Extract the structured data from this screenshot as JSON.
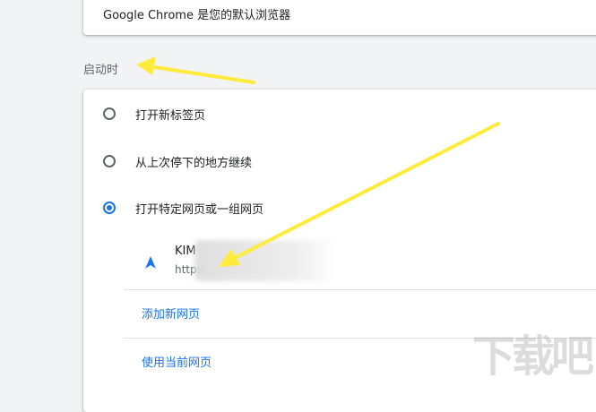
{
  "default_browser": {
    "text": "Google Chrome 是您的默认浏览器"
  },
  "startup": {
    "title": "启动时",
    "options": [
      {
        "label": "打开新标签页",
        "selected": false
      },
      {
        "label": "从上次停下的地方继续",
        "selected": false
      },
      {
        "label": "打开特定网页或一组网页",
        "selected": true
      }
    ],
    "page": {
      "title": "KIM",
      "url": "https:"
    },
    "add_page": "添加新网页",
    "use_current": "使用当前网页"
  },
  "colors": {
    "accent": "#1a73e8",
    "arrow": "#ffeb3b"
  },
  "icons": {
    "site": "navigation-arrow-icon"
  }
}
